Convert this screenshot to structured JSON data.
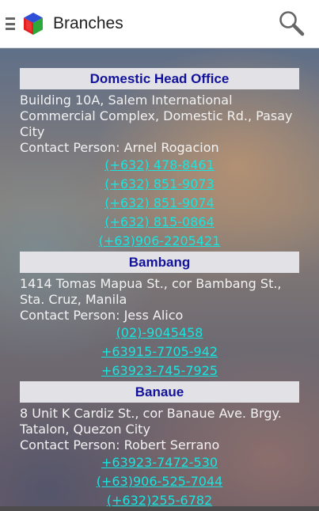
{
  "app": {
    "title": "Branches"
  },
  "icons": {
    "menu": "menu-icon",
    "logo": "app-logo-cube",
    "search": "search-icon"
  },
  "colors": {
    "header_text": "#13129a",
    "link": "#17e6e0",
    "header_bg": "#e2e2e6"
  },
  "branches": [
    {
      "name": "Domestic Head Office",
      "address": "Building 10A, Salem International Commercial Complex, Domestic Rd., Pasay City",
      "contact": "Contact Person: Arnel Rogacion",
      "phones": [
        "(+632) 478-8461",
        "(+632) 851-9073",
        "(+632) 851-9074",
        "(+632) 815-0864",
        "(+63)906-2205421"
      ]
    },
    {
      "name": "Bambang",
      "address": "1414 Tomas Mapua St., cor Bambang St., Sta. Cruz, Manila",
      "contact": "Contact Person: Jess Alico",
      "phones": [
        "(02)-9045458",
        "+63915-7705-942",
        "+63923-745-7925"
      ]
    },
    {
      "name": "Banaue",
      "address": "8 Unit K Cardiz St., cor Banaue Ave. Brgy. Tatalon, Quezon City",
      "contact": "Contact Person: Robert Serrano",
      "phones": [
        "+63923-7472-530",
        "(+63)906-525-7044",
        "(+632)255-6782"
      ]
    }
  ]
}
